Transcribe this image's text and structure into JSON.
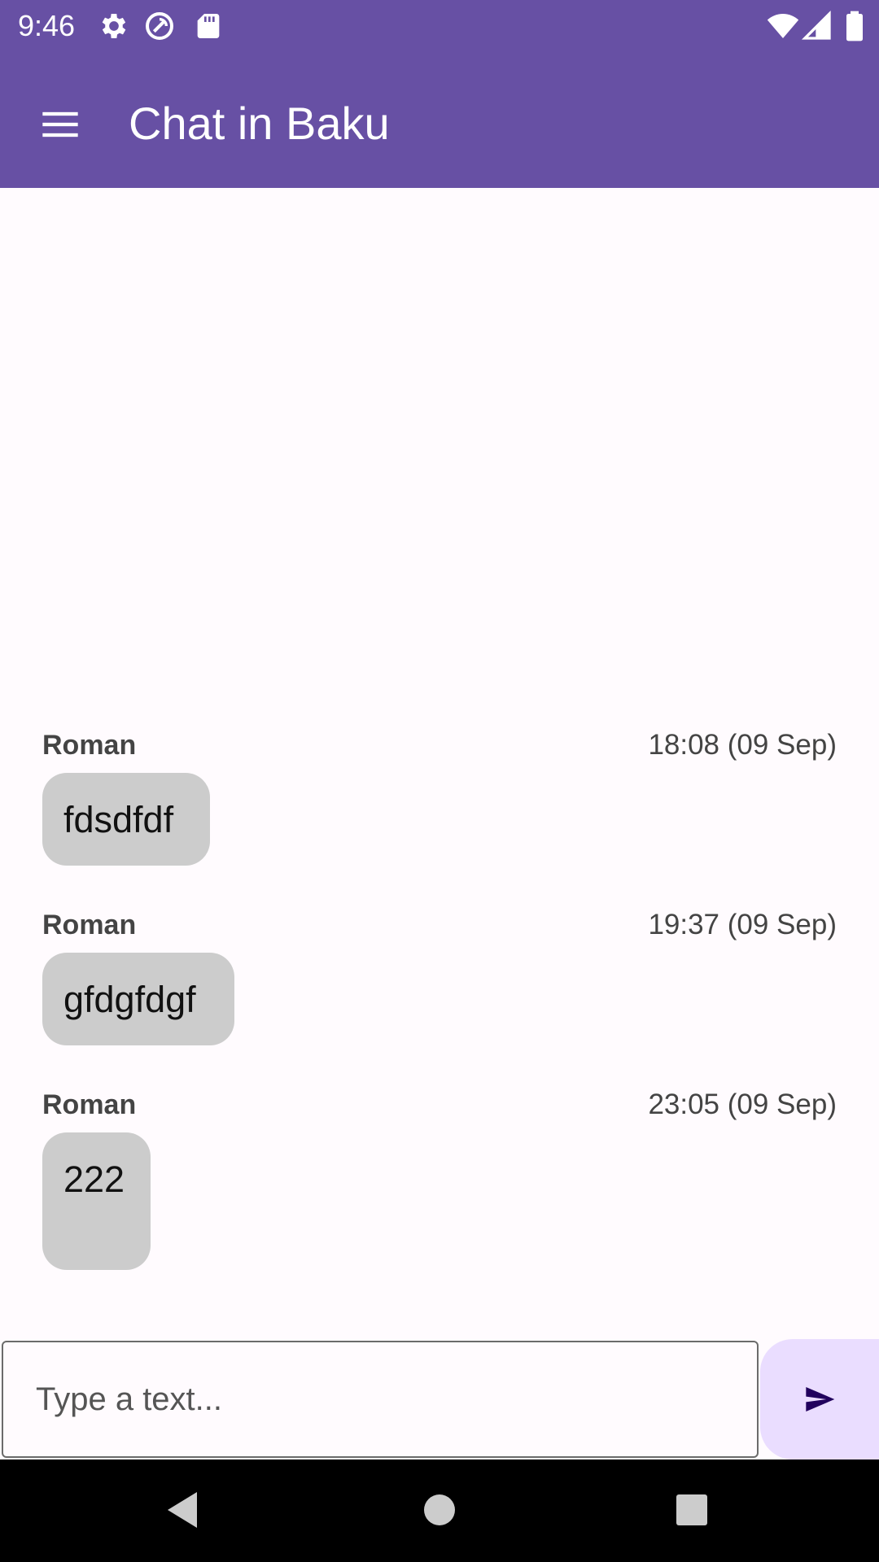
{
  "status_bar": {
    "time": "9:46",
    "left_icons": [
      "gear-icon",
      "sync-off-icon",
      "sd-card-icon"
    ],
    "right_icons": [
      "wifi-icon",
      "signal-icon",
      "battery-icon"
    ]
  },
  "app_bar": {
    "menu_icon": "hamburger-menu-icon",
    "title": "Chat in Baku",
    "color": "#6750a4"
  },
  "messages": [
    {
      "sender": "Roman",
      "time": "18:08 (09 Sep)",
      "text": "fdsdfdf"
    },
    {
      "sender": "Roman",
      "time": "19:37 (09 Sep)",
      "text": "gfdgfdgf"
    },
    {
      "sender": "Roman",
      "time": "23:05 (09 Sep)",
      "text": "222"
    }
  ],
  "composer": {
    "placeholder": "Type a text...",
    "value": "",
    "send_icon": "send-icon",
    "send_button_color": "#eaddff"
  },
  "nav_bar": {
    "icons": [
      "back-icon",
      "home-icon",
      "recents-icon"
    ]
  }
}
